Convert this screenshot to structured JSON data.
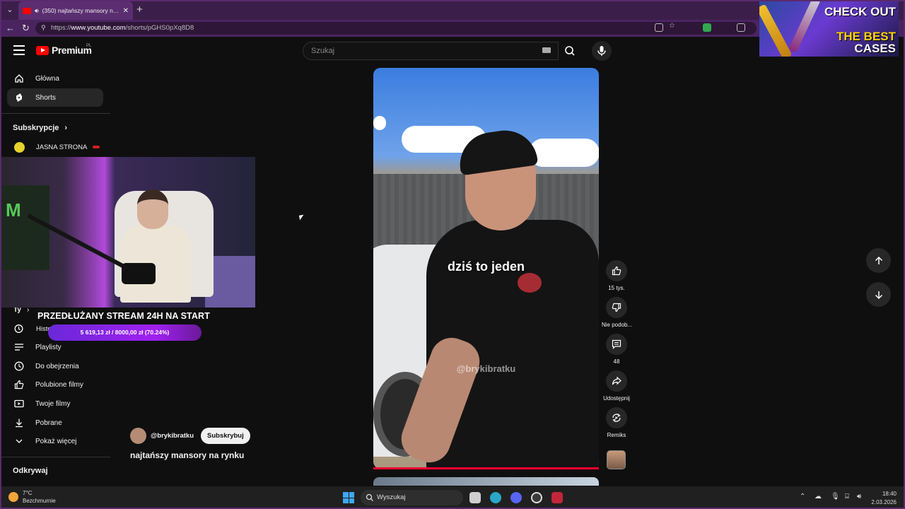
{
  "browser": {
    "tab_title": "(350) najtańszy mansory na ry",
    "new_tab": "+",
    "url_prefix": "https://",
    "url_domain": "www.youtube.com",
    "url_path": "/shorts/pGHS0pXq8D8",
    "win_min": "—",
    "win_max": "⧉",
    "win_close": "✕"
  },
  "youtube": {
    "brand": "Premium",
    "region": "PL",
    "search_placeholder": "Szukaj"
  },
  "sidebar": {
    "items": [
      {
        "label": "Główna",
        "icon": "home-icon"
      },
      {
        "label": "Shorts",
        "icon": "shorts-icon"
      }
    ],
    "subscriptions_heading": "Subskrypcje",
    "subscriptions": [
      {
        "label": "JASNA STRONA"
      }
    ],
    "you_heading": "Ty",
    "history_label": "Histo",
    "you_items": [
      {
        "label": "Playlisty",
        "icon": "playlist-icon"
      },
      {
        "label": "Do obejrzenia",
        "icon": "clock-icon"
      },
      {
        "label": "Polubione filmy",
        "icon": "thumb-up-icon"
      },
      {
        "label": "Twoje filmy",
        "icon": "video-icon"
      },
      {
        "label": "Pobrane",
        "icon": "download-icon"
      },
      {
        "label": "Pokaż więcej",
        "icon": "chevron-down-icon"
      }
    ],
    "explore_heading": "Odkrywaj"
  },
  "stream_overlay": {
    "title": "PRZEDŁUŻANY STREAM 24H NA START",
    "goal_text": "5 619,13 zł  /  8000,00 zł  (70.24%)",
    "goal_fraction": 0.7024
  },
  "short": {
    "caption": "dziś to jeden",
    "watermark": "@brykibratku",
    "channel": "@brykibratku",
    "subscribe": "Subskrybuj",
    "title": "najtańszy mansory na rynku"
  },
  "actions": {
    "likes": "15 tys.",
    "dislike": "Nie podob...",
    "comments": "48",
    "share": "Udostępnij",
    "remix": "Remiks"
  },
  "ad": {
    "line1": "CHECK OUT",
    "line2": "THE BEST",
    "line3": "CASES"
  },
  "taskbar": {
    "temperature": "7°C",
    "weather": "Bezchmurnie",
    "search": "Wyszukaj",
    "time": "18:40",
    "date": "2.03.2026"
  }
}
